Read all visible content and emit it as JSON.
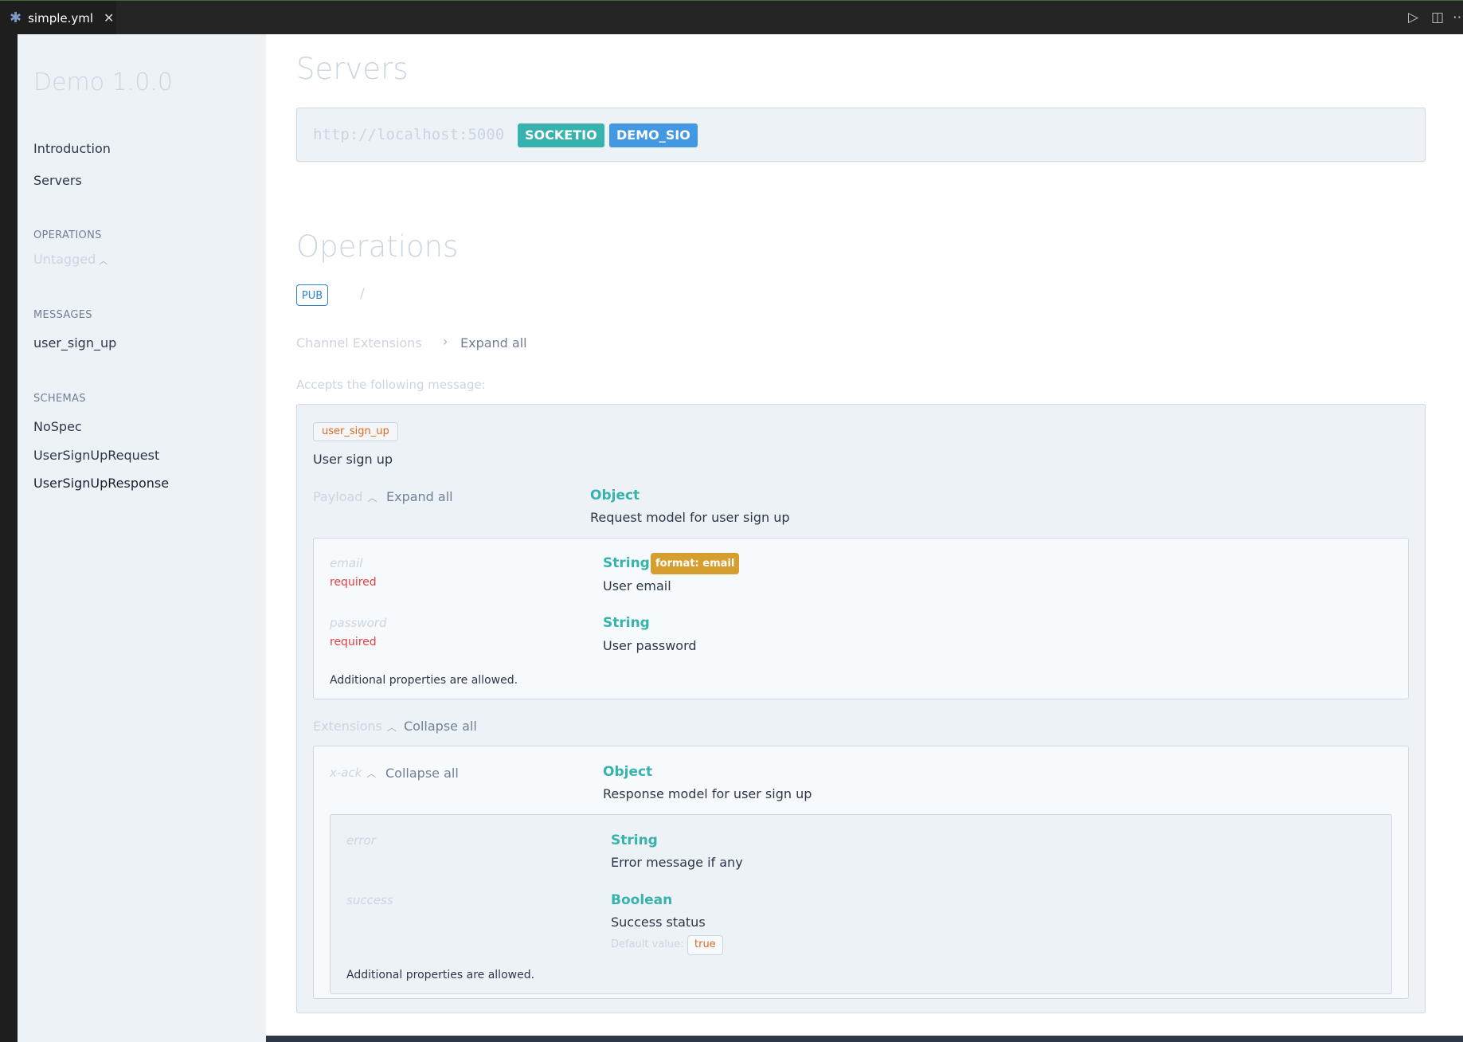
{
  "tab": {
    "icon": "asterisk-file-icon",
    "label": "simple.yml"
  },
  "toolbar": {
    "run_icon": "play-icon",
    "split_icon": "split-editor-icon",
    "more_icon": "more-icon"
  },
  "sidebar": {
    "title": "Demo 1.0.0",
    "links": [
      "Introduction",
      "Servers"
    ],
    "operations_heading": "OPERATIONS",
    "untagged_label": "Untagged",
    "messages_heading": "MESSAGES",
    "messages": [
      "user_sign_up"
    ],
    "schemas_heading": "SCHEMAS",
    "schemas": [
      "NoSpec",
      "UserSignUpRequest",
      "UserSignUpResponse"
    ]
  },
  "servers": {
    "title": "Servers",
    "url": "http://localhost:5000",
    "protocol": "SOCKETIO",
    "name": "DEMO_SIO",
    "protocol_color": "#38b2ac",
    "name_color": "#4299e1"
  },
  "operations": {
    "title": "Operations",
    "method": "PUB",
    "channel": "/",
    "channel_extensions_label": "Channel Extensions",
    "expand_all_label": "Expand all",
    "accepts_label": "Accepts the following message:"
  },
  "message": {
    "name": "user_sign_up",
    "summary": "User sign up",
    "payload_label": "Payload",
    "payload_expand_label": "Expand all",
    "payload_type": "Object",
    "payload_description": "Request model for user sign up",
    "properties": [
      {
        "name": "email",
        "required": "required",
        "type": "String",
        "format": "format: email",
        "description": "User email"
      },
      {
        "name": "password",
        "required": "required",
        "type": "String",
        "description": "User password"
      }
    ],
    "additional_properties": "Additional properties are allowed.",
    "extensions_label": "Extensions",
    "extensions_collapse_label": "Collapse all",
    "ack": {
      "name": "x-ack",
      "collapse_label": "Collapse all",
      "type": "Object",
      "description": "Response model for user sign up",
      "properties": [
        {
          "name": "error",
          "type": "String",
          "description": "Error message if any"
        },
        {
          "name": "success",
          "type": "Boolean",
          "description": "Success status",
          "default_label": "Default value:",
          "default_value": "true"
        }
      ],
      "additional_properties": "Additional properties are allowed."
    }
  }
}
